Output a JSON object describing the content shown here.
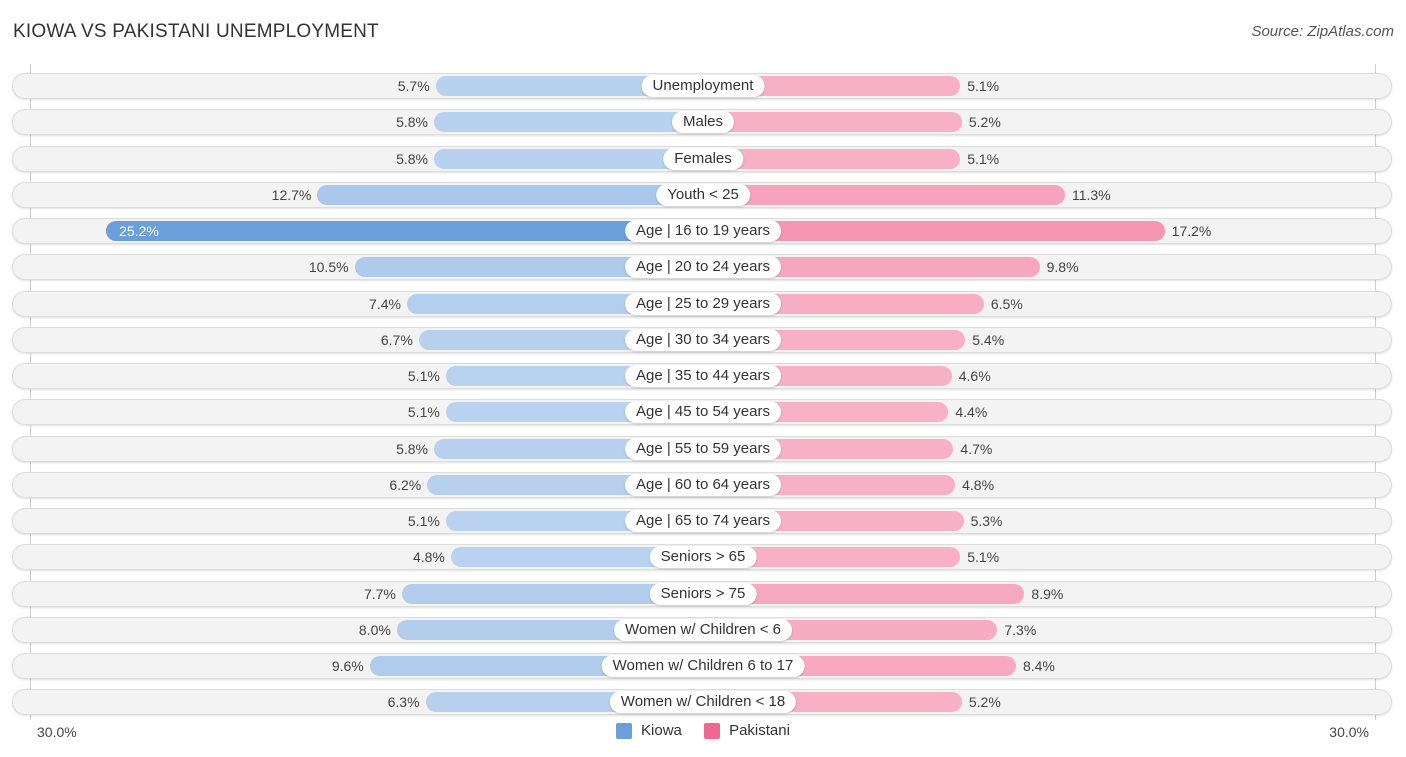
{
  "header": {
    "title": "KIOWA VS PAKISTANI UNEMPLOYMENT",
    "source": "Source: ZipAtlas.com"
  },
  "legend": {
    "items": [
      {
        "label": "Kiowa",
        "color": "#6a9fdc"
      },
      {
        "label": "Pakistani",
        "color": "#f06892"
      }
    ]
  },
  "axis": {
    "left_label": "30.0%",
    "right_label": "30.0%"
  },
  "chart_data": {
    "type": "bar",
    "orientation": "horizontal-diverging",
    "title": "KIOWA VS PAKISTANI UNEMPLOYMENT",
    "xlabel": "",
    "ylabel": "",
    "xlim": [
      0,
      30
    ],
    "unit": "%",
    "legend_position": "bottom-center",
    "categories": [
      "Unemployment",
      "Males",
      "Females",
      "Youth < 25",
      "Age | 16 to 19 years",
      "Age | 20 to 24 years",
      "Age | 25 to 29 years",
      "Age | 30 to 34 years",
      "Age | 35 to 44 years",
      "Age | 45 to 54 years",
      "Age | 55 to 59 years",
      "Age | 60 to 64 years",
      "Age | 65 to 74 years",
      "Seniors > 65",
      "Seniors > 75",
      "Women w/ Children < 6",
      "Women w/ Children 6 to 17",
      "Women w/ Children < 18"
    ],
    "series": [
      {
        "name": "Kiowa",
        "side": "left",
        "color": "#6a9fdc",
        "values": [
          5.7,
          5.8,
          5.8,
          12.7,
          25.2,
          10.5,
          7.4,
          6.7,
          5.1,
          5.1,
          5.8,
          6.2,
          5.1,
          4.8,
          7.7,
          8.0,
          9.6,
          6.3
        ],
        "labels": [
          "5.7%",
          "5.8%",
          "5.8%",
          "12.7%",
          "25.2%",
          "10.5%",
          "7.4%",
          "6.7%",
          "5.1%",
          "5.1%",
          "5.8%",
          "6.2%",
          "5.1%",
          "4.8%",
          "7.7%",
          "8.0%",
          "9.6%",
          "6.3%"
        ]
      },
      {
        "name": "Pakistani",
        "side": "right",
        "color": "#f06892",
        "values": [
          5.1,
          5.2,
          5.1,
          11.3,
          17.2,
          9.8,
          6.5,
          5.4,
          4.6,
          4.4,
          4.7,
          4.8,
          5.3,
          5.1,
          8.9,
          7.3,
          8.4,
          5.2
        ],
        "labels": [
          "5.1%",
          "5.2%",
          "5.1%",
          "11.3%",
          "17.2%",
          "9.8%",
          "6.5%",
          "5.4%",
          "4.6%",
          "4.4%",
          "4.7%",
          "4.8%",
          "5.3%",
          "5.1%",
          "8.9%",
          "7.3%",
          "8.4%",
          "5.2%"
        ]
      }
    ]
  }
}
